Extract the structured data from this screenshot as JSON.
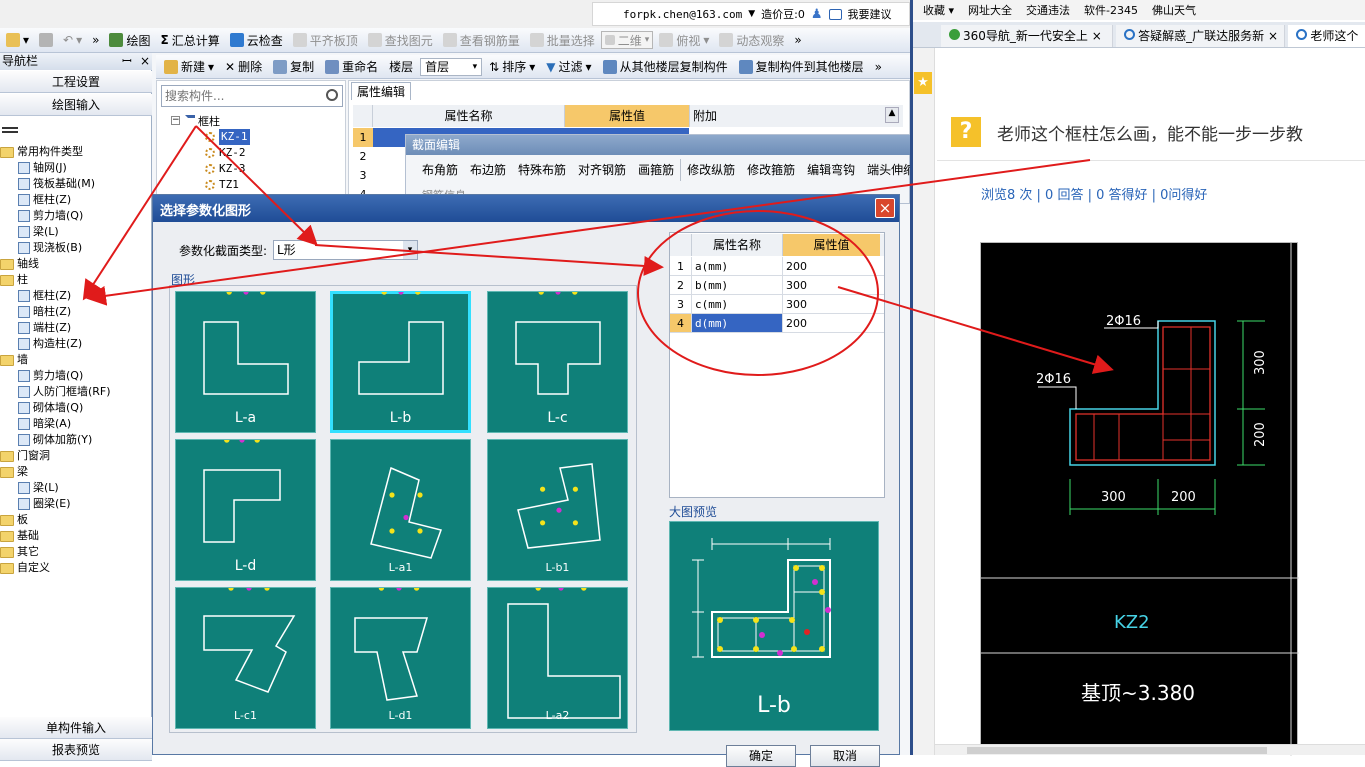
{
  "topbar": {
    "account": "forpk.chen@163.com",
    "price_label": "造价豆:0",
    "suggest_label": "我要建议"
  },
  "toolbar1": {
    "draw": "绘图",
    "sum": "汇总计算",
    "cloud_check": "云检查",
    "align_slab": "平齐板顶",
    "find_elem": "查找图元",
    "view_rebar": "查看钢筋量",
    "batch_select": "批量选择",
    "view_mode": "二维",
    "top_view": "俯视",
    "dyn_observe": "动态观察"
  },
  "toolbar2": {
    "new": "新建",
    "delete": "删除",
    "copy": "复制",
    "rename": "重命名",
    "floor_label": "楼层",
    "floor_value": "首层",
    "sort": "排序",
    "filter": "过滤",
    "copy_from": "从其他楼层复制构件",
    "copy_to": "复制构件到其他楼层"
  },
  "nav": {
    "title": "导航栏",
    "pin": "ꟷ",
    "close": "×",
    "btn_project": "工程设置",
    "btn_draw": "绘图输入",
    "items": [
      {
        "label": "常用构件类型",
        "kind": "folder"
      },
      {
        "label": "轴网(J)",
        "kind": "item"
      },
      {
        "label": "筏板基础(M)",
        "kind": "item"
      },
      {
        "label": "框柱(Z)",
        "kind": "item"
      },
      {
        "label": "剪力墙(Q)",
        "kind": "item"
      },
      {
        "label": "梁(L)",
        "kind": "item"
      },
      {
        "label": "现浇板(B)",
        "kind": "item"
      },
      {
        "label": "轴线",
        "kind": "folder"
      },
      {
        "label": "柱",
        "kind": "folder"
      },
      {
        "label": "框柱(Z)",
        "kind": "item"
      },
      {
        "label": "暗柱(Z)",
        "kind": "item"
      },
      {
        "label": "端柱(Z)",
        "kind": "item"
      },
      {
        "label": "构造柱(Z)",
        "kind": "item"
      },
      {
        "label": "墙",
        "kind": "folder"
      },
      {
        "label": "剪力墙(Q)",
        "kind": "item"
      },
      {
        "label": "人防门框墙(RF)",
        "kind": "item"
      },
      {
        "label": "砌体墙(Q)",
        "kind": "item"
      },
      {
        "label": "暗梁(A)",
        "kind": "item"
      },
      {
        "label": "砌体加筋(Y)",
        "kind": "item"
      },
      {
        "label": "门窗洞",
        "kind": "folder"
      },
      {
        "label": "梁",
        "kind": "folder"
      },
      {
        "label": "梁(L)",
        "kind": "item"
      },
      {
        "label": "圈梁(E)",
        "kind": "item"
      },
      {
        "label": "板",
        "kind": "folder"
      },
      {
        "label": "基础",
        "kind": "folder"
      },
      {
        "label": "其它",
        "kind": "folder"
      },
      {
        "label": "自定义",
        "kind": "folder"
      }
    ],
    "bottom1": "单构件输入",
    "bottom2": "报表预览"
  },
  "search": {
    "placeholder": "搜索构件..."
  },
  "comp_tree": {
    "root": "框柱",
    "items": [
      "KZ-1",
      "KZ-2",
      "KZ-3",
      "TZ1"
    ]
  },
  "prop": {
    "tab": "属性编辑",
    "col_name": "属性名称",
    "col_value": "属性值",
    "col_extra": "附加"
  },
  "section": {
    "title": "截面编辑",
    "tabs": [
      "布角筋",
      "布边筋",
      "特殊布筋",
      "对齐钢筋",
      "画箍筋",
      "修改纵筋",
      "修改箍筋",
      "编辑弯钩",
      "端头伸缩"
    ],
    "info_label": "钢筋信息"
  },
  "dialog": {
    "title": "选择参数化图形",
    "type_label": "参数化截面类型:",
    "type_value": "L形",
    "group_label": "图形",
    "tiles": [
      "L-a",
      "L-b",
      "L-c",
      "L-d",
      "L-a1",
      "L-b1",
      "L-c1",
      "L-d1",
      "L-a2"
    ],
    "params_header": {
      "name": "属性名称",
      "value": "属性值"
    },
    "params": [
      {
        "no": "1",
        "name": "a(mm)",
        "value": "200"
      },
      {
        "no": "2",
        "name": "b(mm)",
        "value": "300"
      },
      {
        "no": "3",
        "name": "c(mm)",
        "value": "300"
      },
      {
        "no": "4",
        "name": "d(mm)",
        "value": "200"
      }
    ],
    "preview_label": "大图预览",
    "preview_name": "L-b",
    "ok": "确定",
    "cancel": "取消",
    "close": "×"
  },
  "browser": {
    "fav": "收藏",
    "links": [
      "网址大全",
      "交通违法",
      "软件-2345",
      "佛山天气"
    ],
    "tabs": [
      "360导航_新一代安全上",
      "答疑解惑_广联达服务新",
      "老师这个"
    ],
    "question": "老师这个框柱怎么画，能不能一步一步教",
    "stats": "浏览8 次 | 0 回答 | 0 答得好 | 0问得好"
  },
  "drawing": {
    "lbl_top": "2Φ16",
    "lbl_left": "2Φ16",
    "dim_300": "300",
    "dim_200": "200",
    "dim_b1": "300",
    "dim_b2": "200",
    "name": "KZ2",
    "elevation": "基顶~3.380"
  }
}
